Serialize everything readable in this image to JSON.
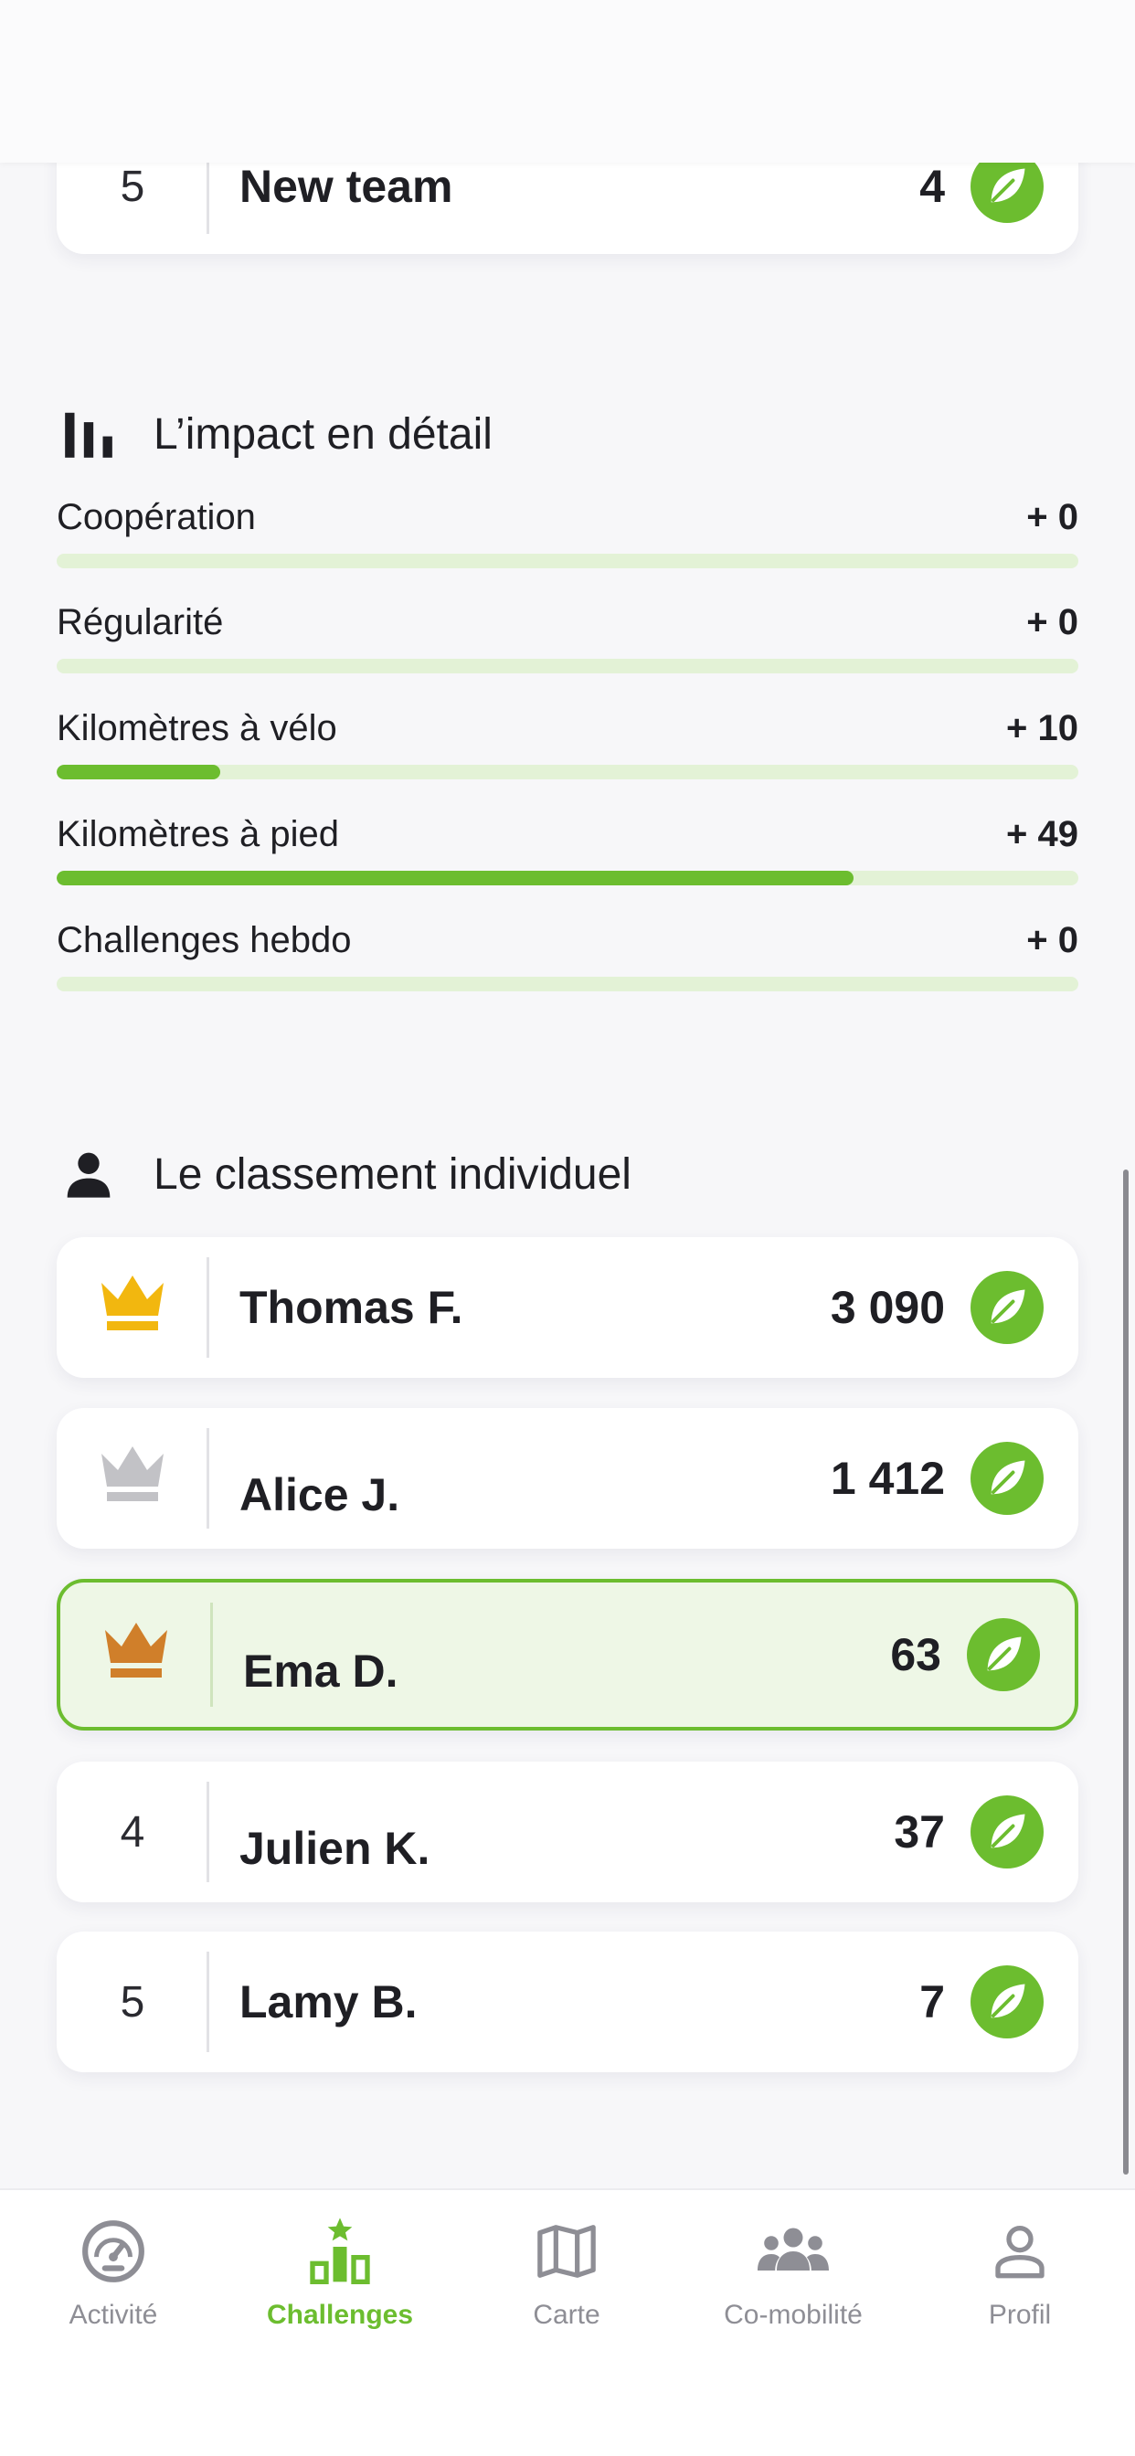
{
  "team_ranking": {
    "last_row": {
      "rank": "5",
      "name": "New team",
      "score": "4"
    }
  },
  "impact": {
    "title": "L’impact en détail",
    "metrics": [
      {
        "label": "Coopération",
        "value": "+ 0",
        "progress": 0
      },
      {
        "label": "Régularité",
        "value": "+ 0",
        "progress": 0
      },
      {
        "label": "Kilomètres à vélo",
        "value": "+ 10",
        "progress": 0.16
      },
      {
        "label": "Kilomètres à pied",
        "value": "+ 49",
        "progress": 0.78
      },
      {
        "label": "Challenges hebdo",
        "value": "+ 0",
        "progress": 0
      }
    ]
  },
  "individual": {
    "title": "Le classement individuel",
    "rows": [
      {
        "rank": "1",
        "rank_icon": "gold-crown-icon",
        "name": "Thomas F.",
        "score": "3 090",
        "current_user": false
      },
      {
        "rank": "2",
        "rank_icon": "silver-crown-icon",
        "name": "Alice J.",
        "score": "1 412",
        "current_user": false
      },
      {
        "rank": "3",
        "rank_icon": "bronze-crown-icon",
        "name": "Ema D.",
        "score": "63",
        "current_user": true
      },
      {
        "rank": "4",
        "name": "Julien K.",
        "score": "37",
        "current_user": false
      },
      {
        "rank": "5",
        "name": "Lamy B.",
        "score": "7",
        "current_user": false
      }
    ]
  },
  "colors": {
    "accent": "#6cbd2f",
    "gold": "#f2b70f",
    "silver": "#c2c2c6",
    "bronze": "#d07f2a",
    "track": "#e3f2d6",
    "current_user_bg": "#eef7e6"
  },
  "tabbar": {
    "tabs": [
      {
        "label": "Activité",
        "icon": "speedometer-icon",
        "active": false
      },
      {
        "label": "Challenges",
        "icon": "podium-icon",
        "active": true
      },
      {
        "label": "Carte",
        "icon": "map-icon",
        "active": false
      },
      {
        "label": "Co-mobilité",
        "icon": "group-icon",
        "active": false
      },
      {
        "label": "Profil",
        "icon": "user-icon",
        "active": false
      }
    ]
  }
}
